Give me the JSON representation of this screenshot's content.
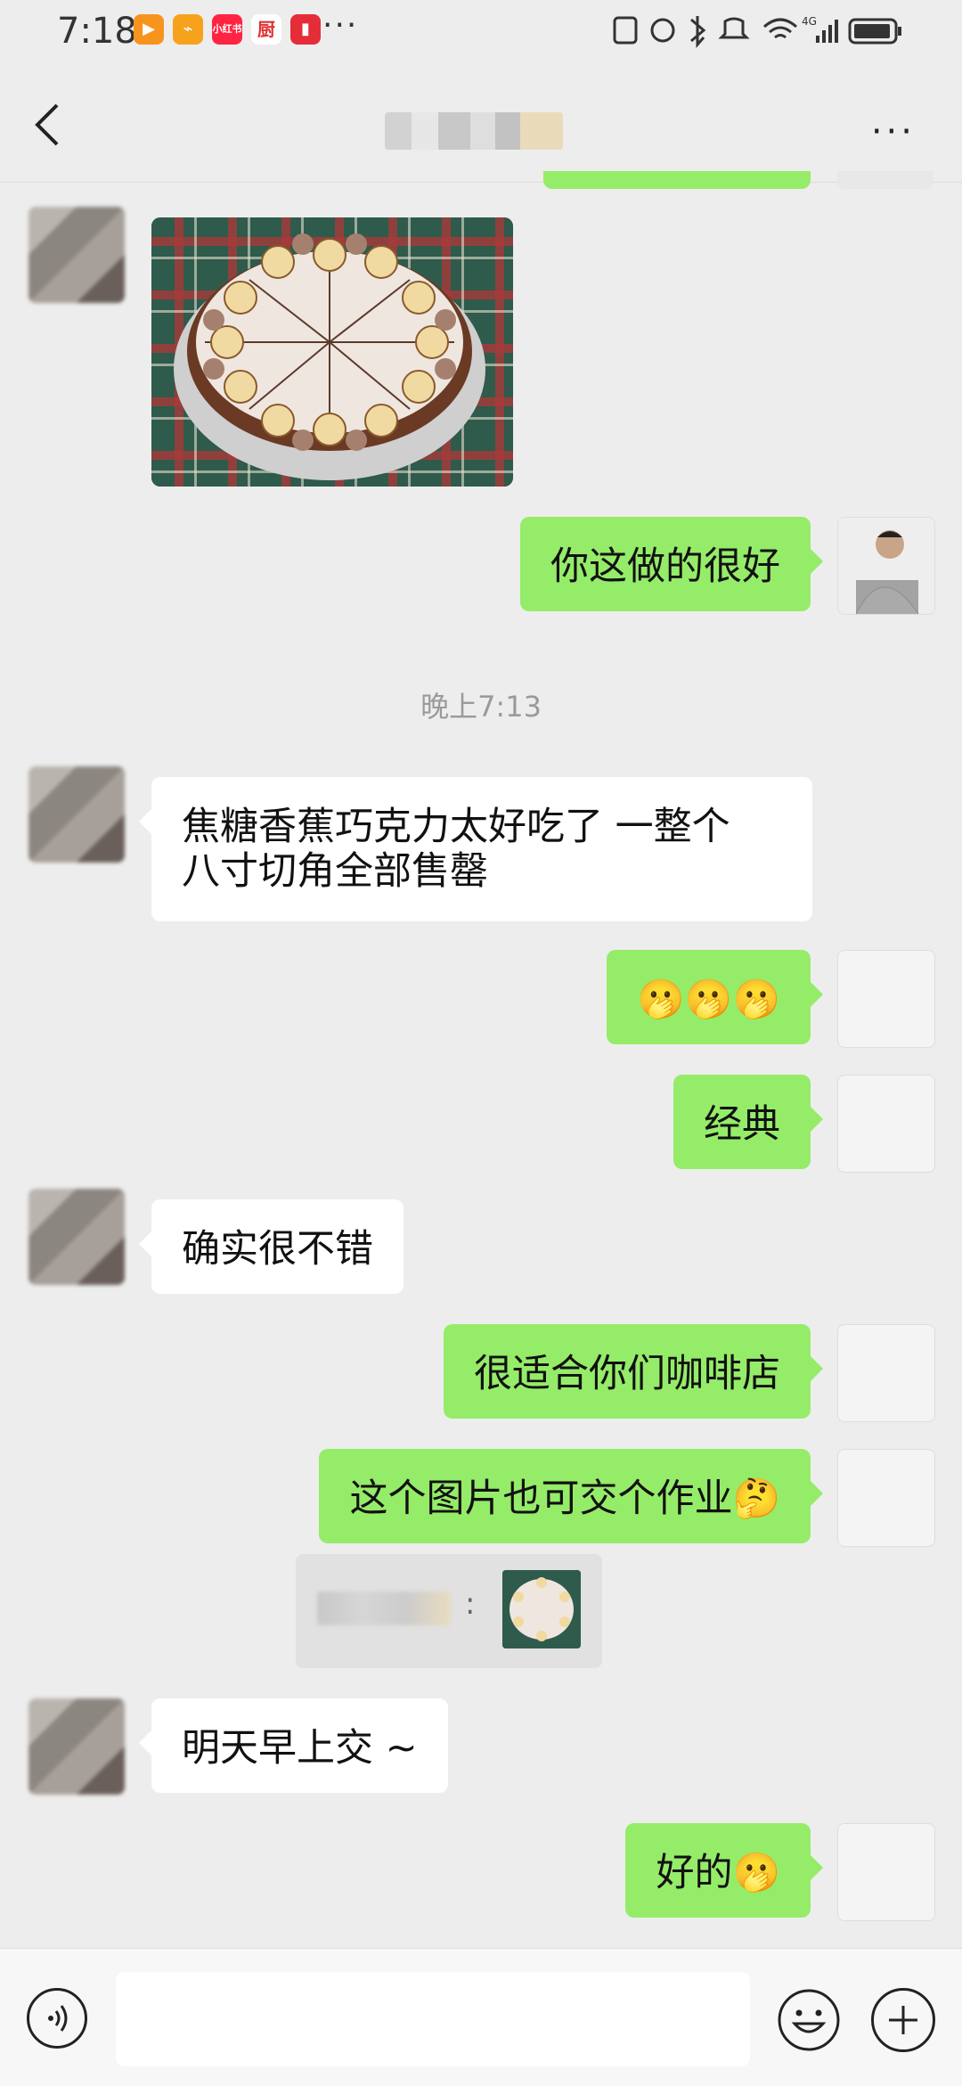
{
  "status_bar": {
    "time": "7:18",
    "app_icons": [
      {
        "name": "video-app-icon",
        "color": "#f7941d",
        "glyph": "▶"
      },
      {
        "name": "note-app-icon",
        "color": "#f7a21d",
        "glyph": "⌁"
      },
      {
        "name": "xiaohongshu-icon",
        "color": "#ff2442",
        "glyph": "小红书"
      },
      {
        "name": "kitchen-app-icon",
        "color": "#ffffff",
        "glyph": "厨"
      },
      {
        "name": "book-app-icon",
        "color": "#e52d3a",
        "glyph": "▮"
      }
    ],
    "more": "···"
  },
  "header": {
    "back_icon": "chevron-left-icon",
    "more_label": "···"
  },
  "colors": {
    "my_bubble": "#95ec69",
    "their_bubble": "#ffffff",
    "background": "#ededed"
  },
  "messages": [
    {
      "side": "left",
      "type": "image"
    },
    {
      "side": "right",
      "text": "你这做的很好"
    },
    {
      "type": "time",
      "text": "晚上7:13"
    },
    {
      "side": "left",
      "text": "焦糖香蕉巧克力太好吃了 一整个\n八寸切角全部售罄"
    },
    {
      "side": "right",
      "text": "🫢🫢🫢"
    },
    {
      "side": "right",
      "text": "经典"
    },
    {
      "side": "left",
      "text": "确实很不错"
    },
    {
      "side": "right",
      "text": "很适合你们咖啡店"
    },
    {
      "side": "right",
      "text": "这个图片也可交个作业🤔"
    },
    {
      "side": "right",
      "type": "quote",
      "colon": ":"
    },
    {
      "side": "left",
      "text": "明天早上交 ~"
    },
    {
      "side": "right",
      "text": "好的🫢"
    }
  ],
  "input_bar": {
    "voice_icon": "voice-icon",
    "emoji_icon": "emoji-icon",
    "plus_icon": "plus-icon"
  }
}
